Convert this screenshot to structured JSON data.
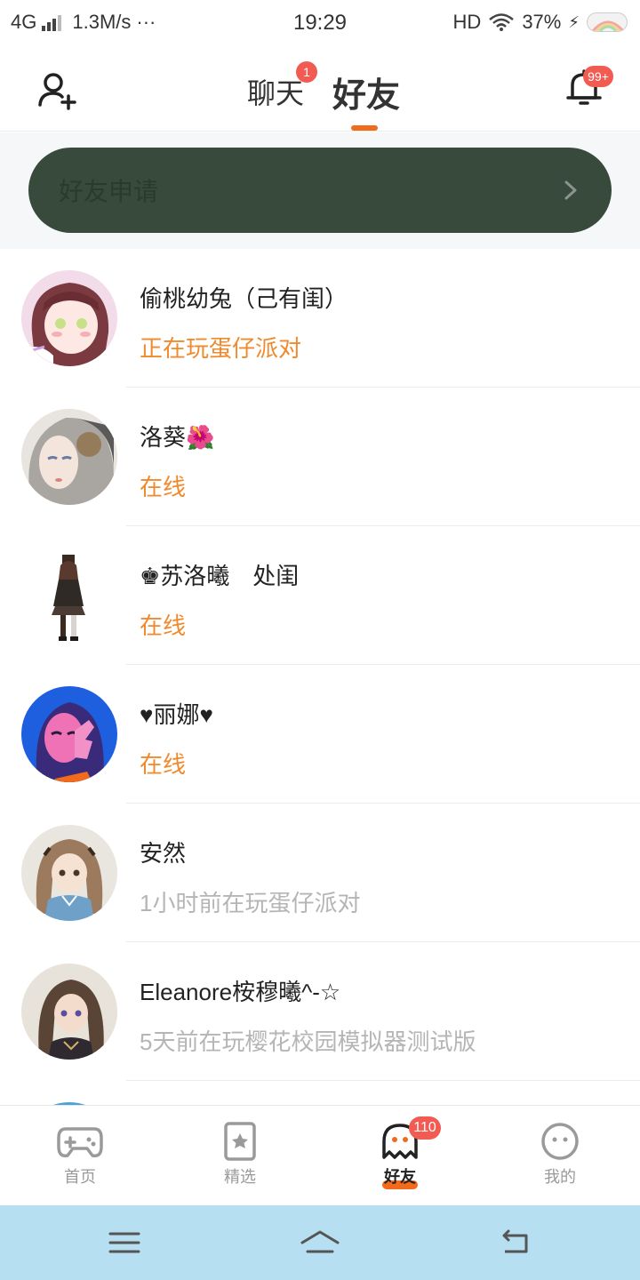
{
  "status_bar": {
    "network": "4G",
    "speed": "1.3M/s",
    "more": "···",
    "time": "19:29",
    "hd": "HD",
    "battery": "37%"
  },
  "header": {
    "chat_tab": "聊天",
    "chat_badge": "1",
    "friends_tab": "好友",
    "notification_badge": "99+",
    "accent_color": "#f26a1b"
  },
  "friend_request": {
    "label": "好友申请",
    "background": "#384a3b"
  },
  "friends": [
    {
      "name": "偷桃幼兔（己有闺）",
      "status": "正在玩蛋仔派对",
      "state": "playing"
    },
    {
      "name": "洛葵🌺",
      "status": "在线",
      "state": "online"
    },
    {
      "name": "♚苏洛曦　处闺",
      "status": "在线",
      "state": "online"
    },
    {
      "name": "♥丽娜♥",
      "status": "在线",
      "state": "online"
    },
    {
      "name": "安然",
      "status": "1小时前在玩蛋仔派对",
      "state": "offline"
    },
    {
      "name": "Eleanore桉穆曦^-☆",
      "status": "5天前在玩樱花校园模拟器测试版",
      "state": "offline"
    }
  ],
  "bottom_nav": {
    "items": [
      {
        "label": "首页",
        "icon": "gamepad-icon"
      },
      {
        "label": "精选",
        "icon": "star-icon"
      },
      {
        "label": "好友",
        "icon": "ghost-icon"
      },
      {
        "label": "我的",
        "icon": "smiley-icon"
      }
    ],
    "active_index": 2,
    "friends_badge": "110"
  },
  "colors": {
    "status_active": "#f08a2c",
    "status_inactive": "#b5b5b5",
    "badge": "#f25b52",
    "system_nav_bg": "#b7dff2"
  }
}
